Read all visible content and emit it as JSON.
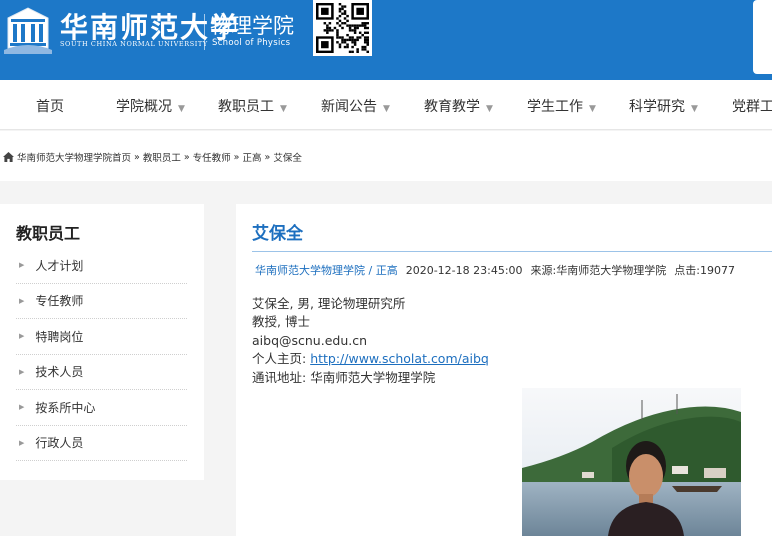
{
  "header": {
    "university_name": "华南师范大学",
    "university_name_en": "SOUTH CHINA NORMAL UNIVERSITY",
    "school_name": "物理学院",
    "school_name_en": "School of Physics"
  },
  "nav": {
    "items": [
      {
        "label": "首页",
        "has_dropdown": false
      },
      {
        "label": "学院概况",
        "has_dropdown": true
      },
      {
        "label": "教职员工",
        "has_dropdown": true
      },
      {
        "label": "新闻公告",
        "has_dropdown": true
      },
      {
        "label": "教育教学",
        "has_dropdown": true
      },
      {
        "label": "学生工作",
        "has_dropdown": true
      },
      {
        "label": "科学研究",
        "has_dropdown": true
      },
      {
        "label": "党群工",
        "has_dropdown": false
      }
    ]
  },
  "breadcrumb": {
    "items": [
      "华南师范大学物理学院首页",
      "教职员工",
      "专任教师",
      "正高",
      "艾保全"
    ],
    "separator": "»"
  },
  "sidebar": {
    "title": "教职员工",
    "items": [
      "人才计划",
      "专任教师",
      "特聘岗位",
      "技术人员",
      "按系所中心",
      "行政人员"
    ]
  },
  "article": {
    "title": "艾保全",
    "meta": {
      "category_link": "华南师范大学物理学院 / 正高",
      "date": "2020-12-18 23:45:00",
      "source_label": "来源:",
      "source": "华南师范大学物理学院",
      "clicks_label": "点击:",
      "clicks": "19077"
    },
    "lines": [
      "艾保全, 男, 理论物理研究所",
      "教授, 博士",
      "aibq@scnu.edu.cn"
    ],
    "homepage_label": "个人主页: ",
    "homepage_url": "http://www.scholat.com/aibq",
    "address_label": "通讯地址: ",
    "address": "华南师范大学物理学院"
  },
  "colors": {
    "brand_blue": "#1d78c8",
    "link_blue": "#1d6fbf"
  },
  "icons": {
    "home": "home-icon",
    "dropdown": "caret-down-icon",
    "list_bullet": "triangle-right-icon"
  }
}
